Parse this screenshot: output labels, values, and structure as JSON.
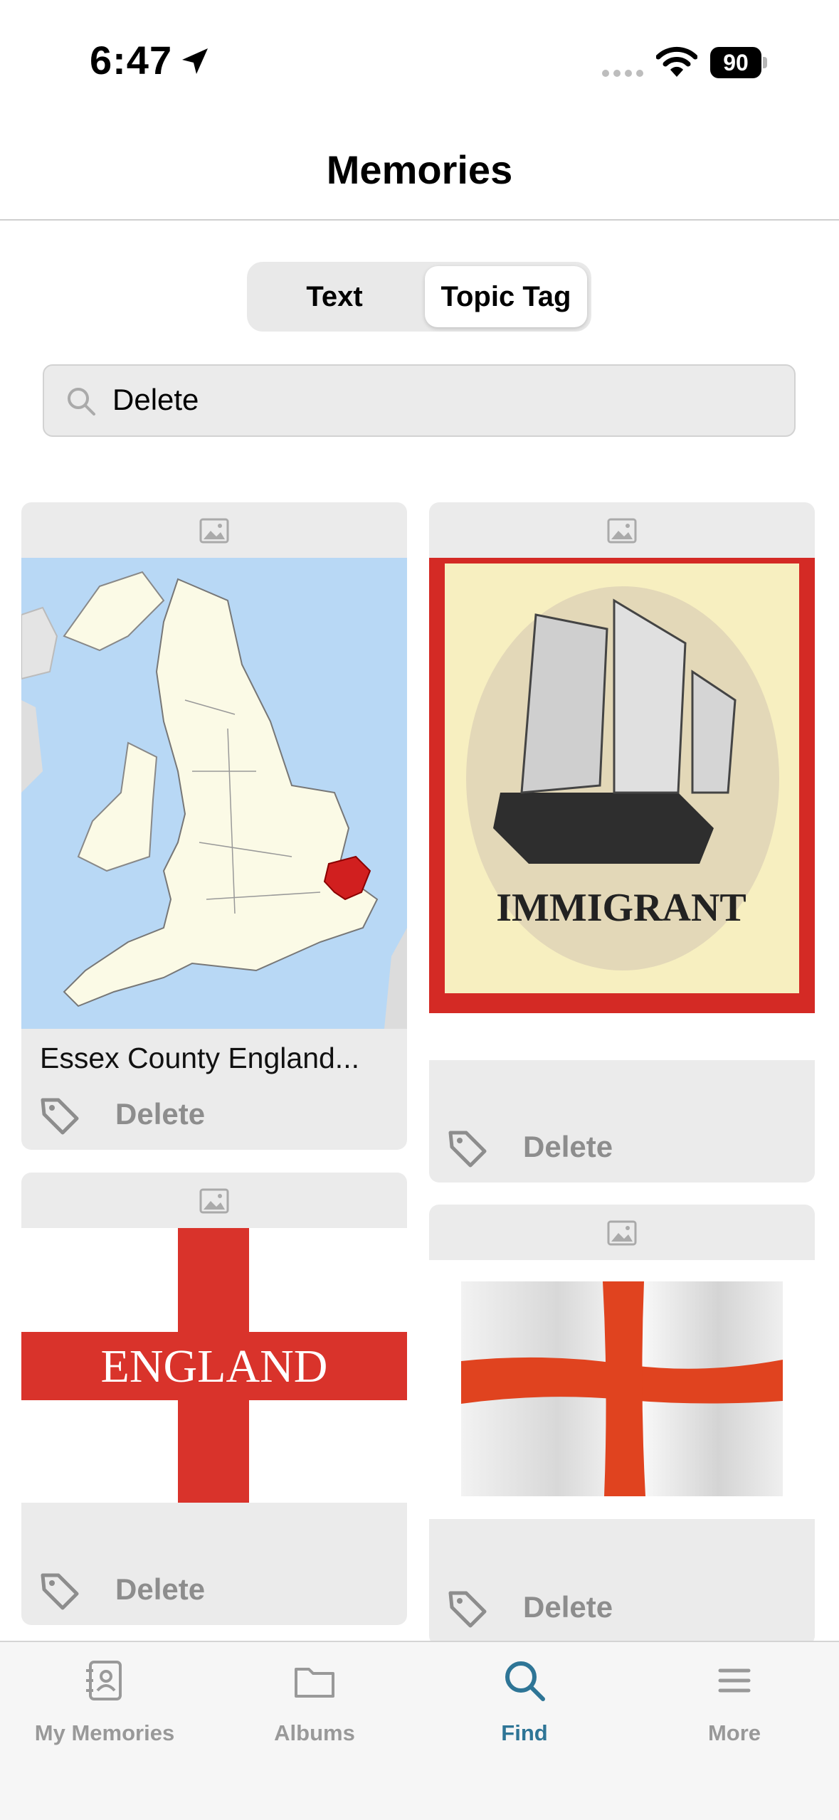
{
  "status": {
    "time": "6:47",
    "battery": "90"
  },
  "header": {
    "title": "Memories"
  },
  "segments": {
    "text": "Text",
    "topic_tag": "Topic Tag",
    "selected": "Topic Tag"
  },
  "search": {
    "value": "Delete"
  },
  "cards": [
    {
      "title": "Essex County England...",
      "tag": "Delete",
      "image": "England county map with Essex highlighted"
    },
    {
      "title": "",
      "tag": "Delete",
      "image": "Immigrant ship emblem"
    },
    {
      "title": "",
      "tag": "Delete",
      "image": "England cross flag"
    },
    {
      "title": "",
      "tag": "Delete",
      "image": "Waving St George's Cross flag"
    }
  ],
  "images": {
    "immigrant_text": "IMMIGRANT",
    "england_text": "ENGLAND"
  },
  "tabbar": {
    "items": [
      {
        "label": "My Memories",
        "icon": "contacts-book-icon"
      },
      {
        "label": "Albums",
        "icon": "folder-icon"
      },
      {
        "label": "Find",
        "icon": "search-icon",
        "active": true
      },
      {
        "label": "More",
        "icon": "menu-icon"
      }
    ]
  },
  "colors": {
    "accent": "#2e7596",
    "flag_red": "#d9332b",
    "essex_red": "#d11f1f",
    "map_sea": "#b8d8f5",
    "map_land": "#fbfae6"
  }
}
